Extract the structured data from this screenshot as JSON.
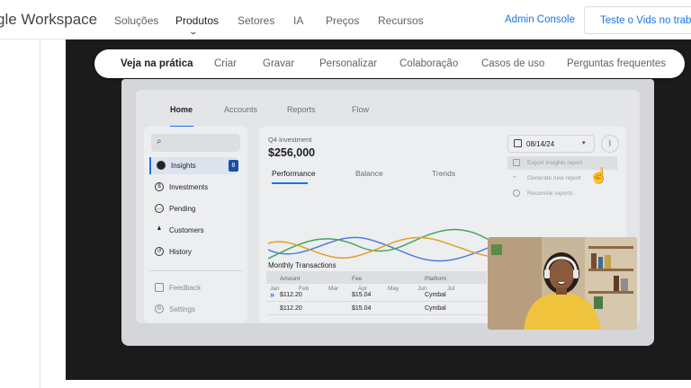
{
  "nav": {
    "logo_text": "gle Workspace",
    "links": [
      "Soluções",
      "Produtos",
      "Setores",
      "IA",
      "Preços",
      "Recursos"
    ],
    "admin": "Admin Console",
    "trial": "Teste o Vids no trabal"
  },
  "pill_tabs": [
    "Veja na prática",
    "Criar",
    "Gravar",
    "Personalizar",
    "Colaboração",
    "Casos de uso",
    "Perguntas frequentes"
  ],
  "app": {
    "tabs": [
      "Home",
      "Accounts",
      "Reports",
      "Flow"
    ],
    "sidebar": {
      "items": [
        {
          "label": "Insights",
          "badge": "8"
        },
        {
          "label": "Investments"
        },
        {
          "label": "Pending"
        },
        {
          "label": "Customers"
        },
        {
          "label": "History"
        }
      ],
      "footer": [
        "Feedback",
        "Settings"
      ]
    },
    "main": {
      "investment_label": "Q4 investment",
      "investment_value": "$256,000",
      "subtabs": [
        "Performance",
        "Balance",
        "Trends"
      ],
      "date": "08/14/24",
      "menu": [
        "Export insights report",
        "Generate new report",
        "Reconcile reports"
      ],
      "months": [
        "Jan",
        "Feb",
        "Mar",
        "Apr",
        "May",
        "Jun",
        "Jul"
      ],
      "transactions": {
        "title": "Monthly Transactions",
        "headers": [
          "Amount",
          "Fee",
          "Platform"
        ],
        "rows": [
          [
            "$112.20",
            "$15.04",
            "Cymbal"
          ],
          [
            "$112.20",
            "$15.04",
            "Cymbal"
          ]
        ]
      }
    },
    "line_colors": {
      "blue": "#4a7fe0",
      "green": "#45a55b",
      "gold": "#e0a324"
    }
  }
}
